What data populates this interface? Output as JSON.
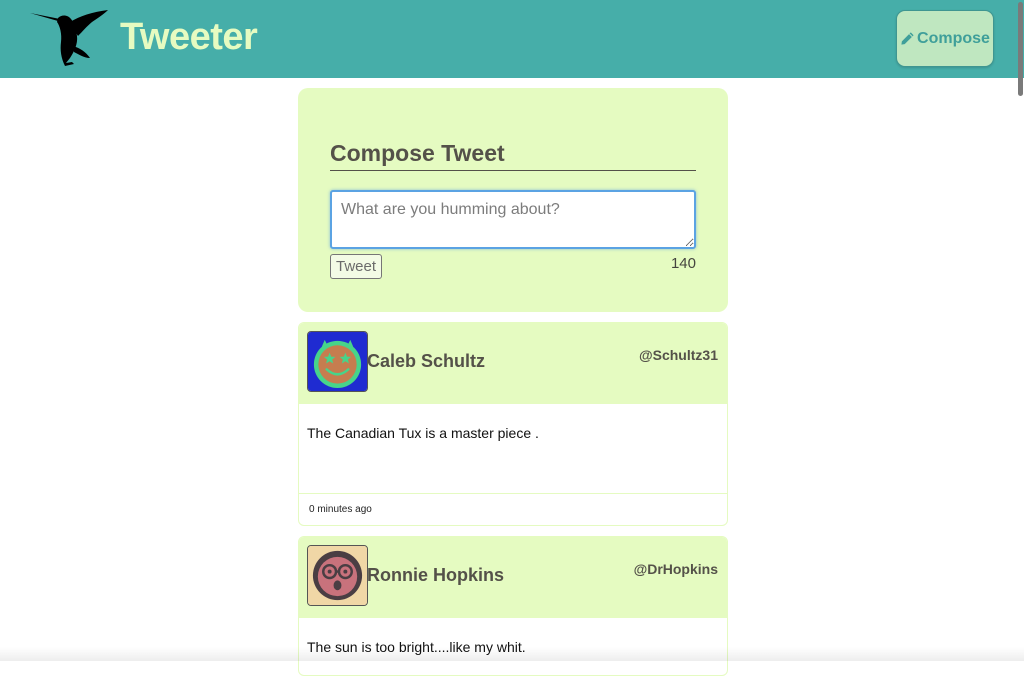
{
  "nav": {
    "brand_title": "Tweeter",
    "logo_icon": "hummingbird-logo",
    "compose_label": "Compose",
    "compose_icon": "pencil-icon",
    "colors": {
      "bar": "#46aea9",
      "title": "#e6fbc1",
      "compose_bg": "#bfe7c0",
      "compose_text": "#3f9f9a"
    }
  },
  "compose": {
    "heading": "Compose Tweet",
    "placeholder": "What are you humming about?",
    "value": "",
    "submit_label": "Tweet",
    "counter": "140",
    "colors": {
      "panel": "#e5fbc1"
    }
  },
  "tweets": [
    {
      "name": "Caleb Schultz",
      "handle": "@Schultz31",
      "text": "The Canadian Tux is a master piece .",
      "time": "0 minutes ago",
      "avatar_icon": "star-eyes-smiley-avatar"
    },
    {
      "name": "Ronnie Hopkins",
      "handle": "@DrHopkins",
      "text": "The sun is too bright....like my whit.",
      "time": "",
      "avatar_icon": "glasses-surprised-face-avatar"
    }
  ]
}
